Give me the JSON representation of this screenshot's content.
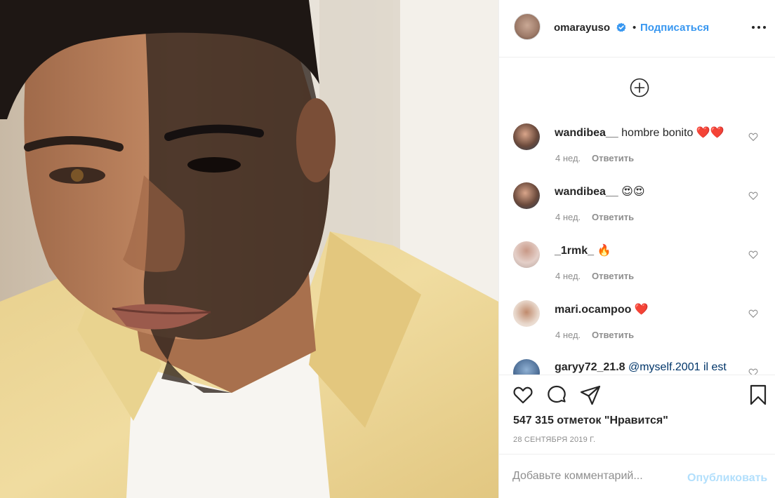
{
  "post": {
    "author": "omarayuso",
    "verified": true,
    "separator": "•",
    "follow_label": "Подписаться",
    "more_icon": "more-horizontal-icon"
  },
  "comments": [
    {
      "user": "wandibea__",
      "text": "hombre bonito",
      "emoji": "❤️❤️",
      "age": "4 нед.",
      "reply_label": "Ответить"
    },
    {
      "user": "wandibea__",
      "text": "",
      "emoji": "😍😍",
      "age": "4 нед.",
      "reply_label": "Ответить"
    },
    {
      "user": "_1rmk_",
      "text": "",
      "emoji": "🔥",
      "age": "4 нед.",
      "reply_label": "Ответить"
    },
    {
      "user": "mari.ocampoo",
      "text": "",
      "emoji": "❤️",
      "age": "4 нед.",
      "reply_label": "Ответить"
    },
    {
      "user": "garyy72_21.8",
      "text": "@myself.2001 il est",
      "emoji": "",
      "age": "",
      "reply_label": ""
    }
  ],
  "actions": {
    "likes": "547 315 отметок \"Нравится\"",
    "date": "28 СЕНТЯБРЯ 2019 Г."
  },
  "add_comment": {
    "placeholder": "Добавьте комментарий...",
    "publish_label": "Опубликовать"
  },
  "colors": {
    "link": "#3897f0",
    "text": "#262626",
    "muted": "#8e8e8e",
    "publish_disabled": "#b2dffc",
    "heart_red": "#ed4956"
  }
}
